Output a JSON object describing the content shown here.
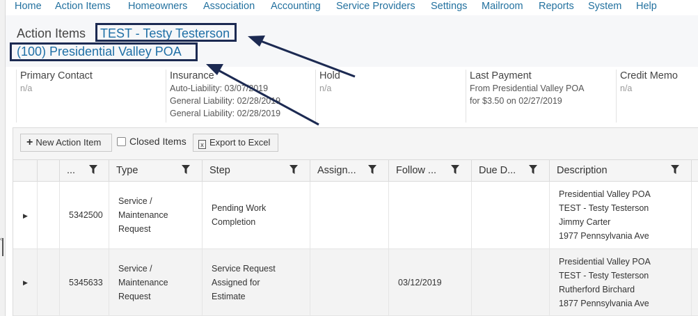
{
  "nav": [
    "Home",
    "Action Items",
    "Homeowners",
    "Association",
    "Accounting",
    "Service Providers",
    "Settings",
    "Mailroom",
    "Reports",
    "System",
    "Help"
  ],
  "header": {
    "title": "Action Items",
    "owner_link": "TEST - Testy Testerson",
    "association_link": "(100) Presidential Valley POA"
  },
  "info": {
    "primary_contact": {
      "label": "Primary Contact",
      "value": "n/a"
    },
    "insurance": {
      "label": "Insurance",
      "lines": [
        "Auto-Liability: 03/07/2019",
        "General Liability: 02/28/2019",
        "General Liability: 02/28/2019"
      ]
    },
    "hold": {
      "label": "Hold",
      "value": "n/a"
    },
    "last_payment": {
      "label": "Last Payment",
      "lines": [
        "From Presidential Valley POA",
        "for $3.50 on 02/27/2019"
      ]
    },
    "credit_memo": {
      "label": "Credit Memo",
      "value": "n/a"
    }
  },
  "toolbar": {
    "new_action_item": "New Action Item",
    "closed_items": "Closed Items",
    "export_excel": "Export to Excel"
  },
  "grid": {
    "columns": [
      "...",
      "Type",
      "Step",
      "Assign...",
      "Follow ...",
      "Due D...",
      "Description"
    ],
    "rows": [
      {
        "id": "5342500",
        "type": [
          "Service /",
          "Maintenance",
          "Request"
        ],
        "step": [
          "Pending Work",
          "Completion"
        ],
        "assigned": "",
        "follow_up": "",
        "due_date": "",
        "description": [
          "Presidential Valley POA",
          "TEST - Testy Testerson",
          "Jimmy Carter",
          "1977 Pennsylvania Ave"
        ]
      },
      {
        "id": "5345633",
        "type": [
          "Service /",
          "Maintenance",
          "Request"
        ],
        "step": [
          "Service Request",
          "Assigned for",
          "Estimate"
        ],
        "assigned": "",
        "follow_up": "03/12/2019",
        "due_date": "",
        "description": [
          "Presidential Valley POA",
          "TEST - Testy Testerson",
          "Rutherford Birchard",
          "1877 Pennsylvania Ave"
        ]
      }
    ]
  },
  "colors": {
    "link": "#1f6fa6",
    "highlight_box": "#1c2a52",
    "nav": "#23719f"
  }
}
